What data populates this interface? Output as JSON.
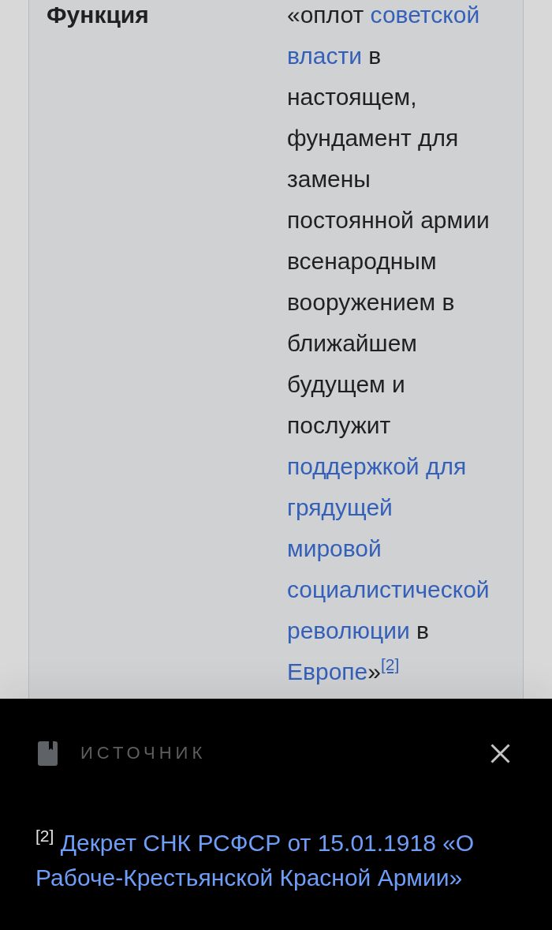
{
  "infobox": {
    "rows": [
      {
        "label": "Функция",
        "value": [
          {
            "kind": "text",
            "text": "«оплот "
          },
          {
            "kind": "link",
            "text": "советской власти"
          },
          {
            "kind": "text",
            "text": " в настоящем, фундамент для замены постоянной армии всенародным вооружением в ближайшем будущем и послужит "
          },
          {
            "kind": "link",
            "text": "поддержкой для грядущей мировой социалистической революции"
          },
          {
            "kind": "text",
            "text": " в "
          },
          {
            "kind": "link",
            "text": "Европе"
          },
          {
            "kind": "text",
            "text": "»"
          },
          {
            "kind": "ref",
            "text": "[2]"
          }
        ]
      }
    ]
  },
  "reference_sheet": {
    "title": "ИСТОЧНИК",
    "reference": {
      "number": "[2]",
      "link": "Декрет СНК РСФСР от 15.01.1918 «О Рабоче-Крестьянской Красной Армии»"
    }
  }
}
